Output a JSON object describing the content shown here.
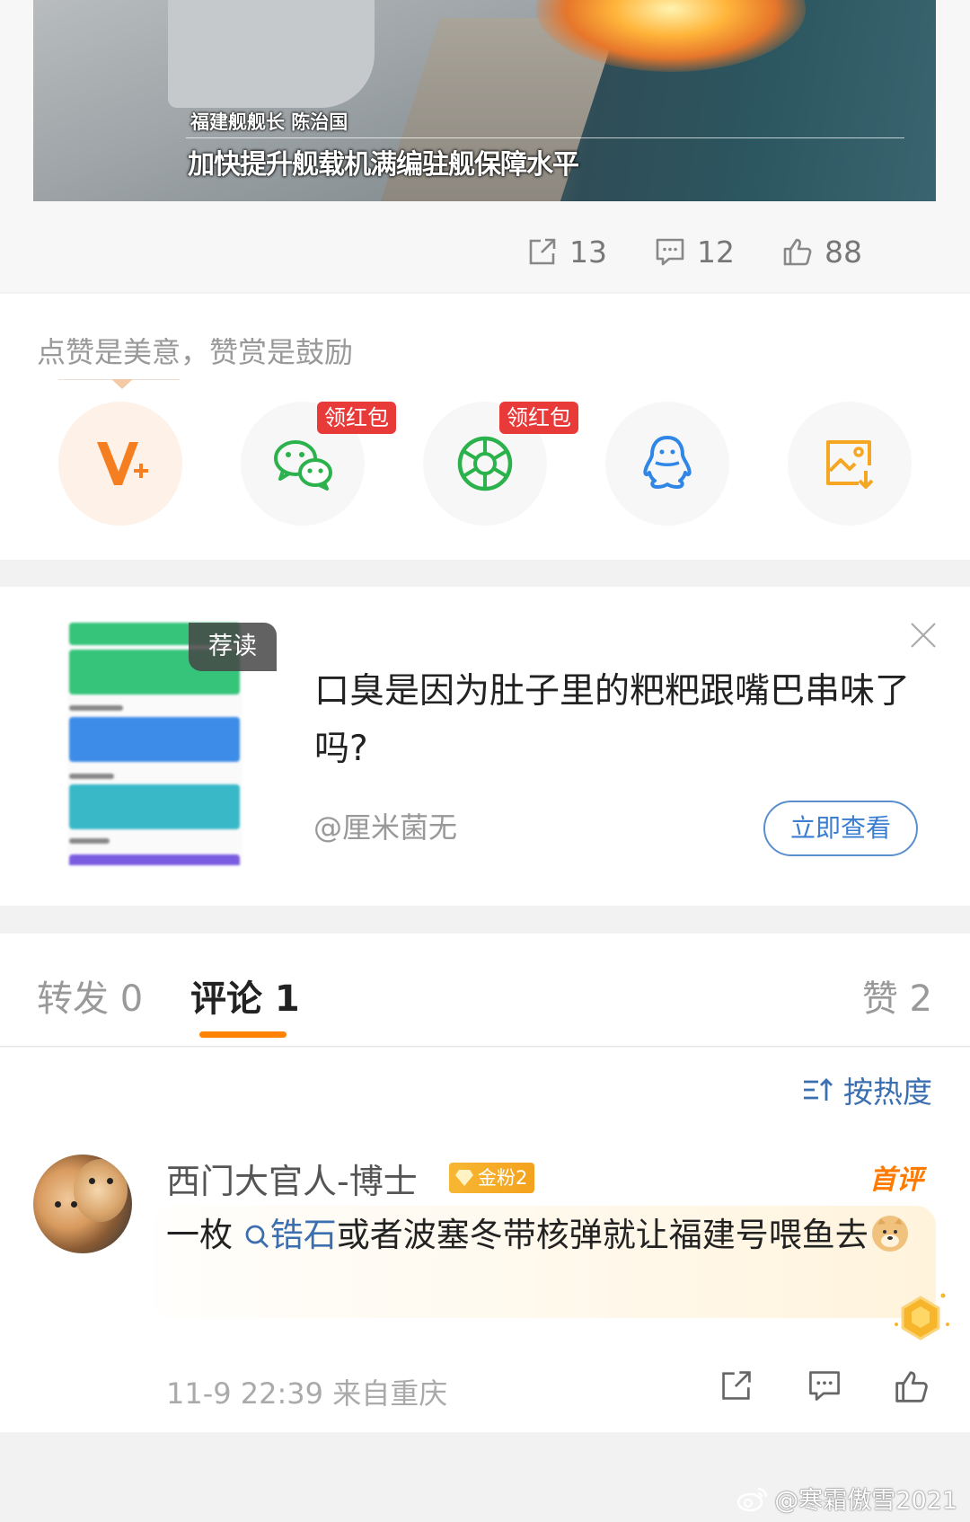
{
  "video": {
    "caption_small": "福建舰舰长 陈治国",
    "caption_big": "加快提升舰载机满编驻舰保障水平"
  },
  "post_actions": {
    "repost_count": "13",
    "comment_count": "12",
    "like_count": "88"
  },
  "reward": {
    "hint": "点赞是美意，赞赏是鼓励",
    "options": [
      {
        "icon": "v-plus-icon"
      },
      {
        "icon": "wechat-icon",
        "tag": "领红包"
      },
      {
        "icon": "moments-icon",
        "tag": "领红包"
      },
      {
        "icon": "qq-icon"
      },
      {
        "icon": "save-image-icon"
      }
    ]
  },
  "recommended": {
    "badge": "荐读",
    "title": "口臭是因为肚子里的粑粑跟嘴巴串味了吗?",
    "author": "@厘米菌无",
    "view_button": "立即查看"
  },
  "tabs": {
    "repost": "转发 0",
    "comment": "评论 1",
    "like": "赞 2"
  },
  "sort": {
    "label": "按热度"
  },
  "comment": {
    "username": "西门大官人-博士",
    "fan_badge": "金粉2",
    "first_label": "首评",
    "text_before": "一枚 ",
    "keyword": "锆石",
    "text_after": "或者波塞冬带核弹就让福建号喂鱼去",
    "meta": "11-9 22:39  来自重庆"
  },
  "watermark": {
    "text": "@寒霜傲雪2021"
  },
  "colors": {
    "accent_orange": "#ff8200",
    "link_blue": "#3b6fb0",
    "red_tag": "#e93a3a"
  }
}
